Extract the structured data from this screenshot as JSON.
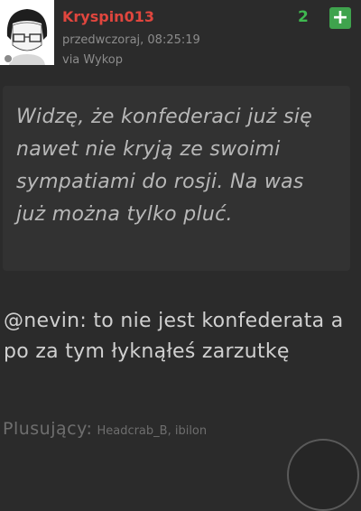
{
  "post": {
    "username": "Kryspin013",
    "timestamp": "przedwczoraj, 08:25:19",
    "via": "via Wykop",
    "vote_count": "2",
    "plus_label": "+",
    "quote": "Widzę, że konfederaci już się nawet nie kryją ze swoimi sympatiami do rosji. Na was już można tylko pluć.",
    "reply": "@nevin: to nie jest konfederata a po za tym łyknąłeś zarzutkę",
    "plusers_label": "Plusujący:",
    "plusers_names": "Headcrab_B, ibilon"
  },
  "colors": {
    "background": "#2b2b2b",
    "username": "#e0463e",
    "vote": "#3fb950",
    "plus_button": "#3fa34d"
  },
  "icons": {
    "avatar": "anime-avatar-glasses",
    "plus": "plus-icon",
    "status": "status-dot-icon"
  }
}
